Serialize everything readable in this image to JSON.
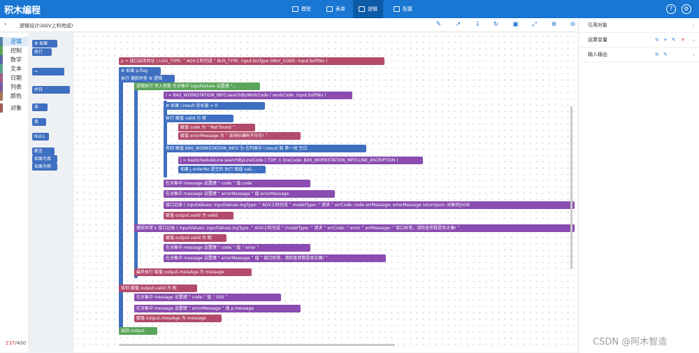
{
  "app": {
    "title": "积木编程"
  },
  "nav": [
    {
      "label": "模型",
      "icon": "model-icon"
    },
    {
      "label": "表单",
      "icon": "form-icon"
    },
    {
      "label": "逻辑",
      "icon": "logic-icon",
      "active": true
    },
    {
      "label": "配置",
      "icon": "config-icon"
    }
  ],
  "top_icons": {
    "help": "?",
    "settings": "⚙"
  },
  "toolbar": {
    "back": "‹",
    "breadcrumb": "逻辑设计(AGV上料完成)"
  },
  "categories": [
    {
      "label": "逻辑",
      "color": "#5b80a5",
      "active": true
    },
    {
      "label": "控制",
      "color": "#5ba55b"
    },
    {
      "label": "数学",
      "color": "#5b67a5"
    },
    {
      "label": "文本",
      "color": "#5ba58c"
    },
    {
      "label": "日期",
      "color": "#a55b80"
    },
    {
      "label": "列表",
      "color": "#745ba5"
    },
    {
      "label": "颜色",
      "color": "#a5745b"
    },
    {
      "label": "对象",
      "color": "#a55b5b"
    }
  ],
  "flyout": [
    {
      "label": "⚙ 如果",
      "color": "#3f6fc0"
    },
    {
      "label": "执行",
      "color": "#3f6fc0"
    },
    {
      "label": "=",
      "color": "#3f6fc0"
    },
    {
      "label": "并且",
      "color": "#3f6fc0"
    },
    {
      "label": "非",
      "color": "#3f6fc0"
    },
    {
      "label": "真",
      "color": "#3f6fc0"
    },
    {
      "label": "NULL",
      "color": "#3f6fc0"
    },
    {
      "label": "断言",
      "color": "#3f6fc0"
    },
    {
      "label": "如果为真",
      "color": "#3f6fc0"
    },
    {
      "label": "如果为假",
      "color": "#3f6fc0"
    }
  ],
  "blocks": [
    {
      "text": "p = 接口启用验证 ( LOG_TYPE: “ AGV上料完成 ” BUS_TYPE: input.bizType ONLY_CODE: input.bsPtNo )",
      "color": "#b34a6a"
    },
    {
      "text": "⚙ 如果   p.flag",
      "color": "#3f6fc0"
    },
    {
      "text": "执行   捕获异常 ⚙ 逻辑",
      "color": "#3f6fc0"
    },
    {
      "text": "逻辑执行   传入参数 在对象中 inputValues 设置键 “...",
      "color": "#5ba55b"
    },
    {
      "text": "i = BAS_WORKSTATION_INFO.searchByWorkCode ( workCode: input.bsPtNo )",
      "color": "#8a4cb0"
    },
    {
      "text": "⚙ 如果   i.result 的长度 = 0",
      "color": "#3f6fc0"
    },
    {
      "text": "执行   赋值 valid 为 假",
      "color": "#3f6fc0"
    },
    {
      "text": "赋值 code 为 “ Not found ”",
      "color": "#b34a6a"
    },
    {
      "text": "赋值 errorMessage 为 “ 该地标编码不存在! ”",
      "color": "#b34a6a"
    },
    {
      "text": "否则   赋值 BAS_WORKSTATION_INFO 为 在列表中 i.result 取 第一项 空白",
      "color": "#3f6fc0"
    },
    {
      "text": "j = basScheduleLine.searchByLineCode ( TOP: 1 lineCode: BAS_WORKSTATION_INFO.LINE_ASCRIPTION )",
      "color": "#8a4cb0"
    },
    {
      "text": "如果 j.orderNo 是空的 执行 赋值 vali...",
      "color": "#3f6fc0"
    },
    {
      "text": "在对象中 message 设置键 “ code ” 值 code",
      "color": "#8a4cb0"
    },
    {
      "text": "在对象中 message 设置键 “ errorMessage ” 值 errorMessage",
      "color": "#8a4cb0"
    },
    {
      "text": "接口记录 ( inputValues: inputValues logType: “ AGV上料完成 ” modelType: “ 请求 ” errCode: code errMessage: errorMessage returnJson: 对象转JSON",
      "color": "#8a4cb0"
    },
    {
      "text": "赋值 output.valid 为 valid",
      "color": "#b34a6a"
    },
    {
      "text": "捕获异常 k   接口记录 ( inputValues: inputValues logType: “ AGV上料完成 ” modelType: “ 请求 ” errCode: “ error ” errMessage: “ 接口异常，请检查参数是否正确! ”",
      "color": "#8a4cb0"
    },
    {
      "text": "赋值 output.valid 为 假",
      "color": "#b34a6a"
    },
    {
      "text": "在对象中 message 设置键 “ code ” 值 “ error ”",
      "color": "#8a4cb0"
    },
    {
      "text": "在对象中 message 设置键 “ errorMessage ” 值 “ 接口异常，请检查参数是否正确! ”",
      "color": "#8a4cb0"
    },
    {
      "text": "最终执行   赋值 output.messAge 为 message",
      "color": "#b34a6a"
    },
    {
      "text": "否则   赋值 output.valid 为 假",
      "color": "#b34a6a"
    },
    {
      "text": "在对象中 message 设置键 “ code ” 值 “ 500 ”",
      "color": "#8a4cb0"
    },
    {
      "text": "在对象中 message 设置键 “ errorMessage ” 值 p.message",
      "color": "#8a4cb0"
    },
    {
      "text": "赋值 output.messAge 为 message",
      "color": "#b34a6a"
    },
    {
      "text": "返回 output",
      "color": "#5ba55b"
    }
  ],
  "counter": {
    "current": "237",
    "total": "/400"
  },
  "right_panel": [
    {
      "label": "引用对象"
    },
    {
      "label": "运算变量"
    },
    {
      "label": "输入输出"
    }
  ],
  "watermark": "CSDN @阿木智造"
}
